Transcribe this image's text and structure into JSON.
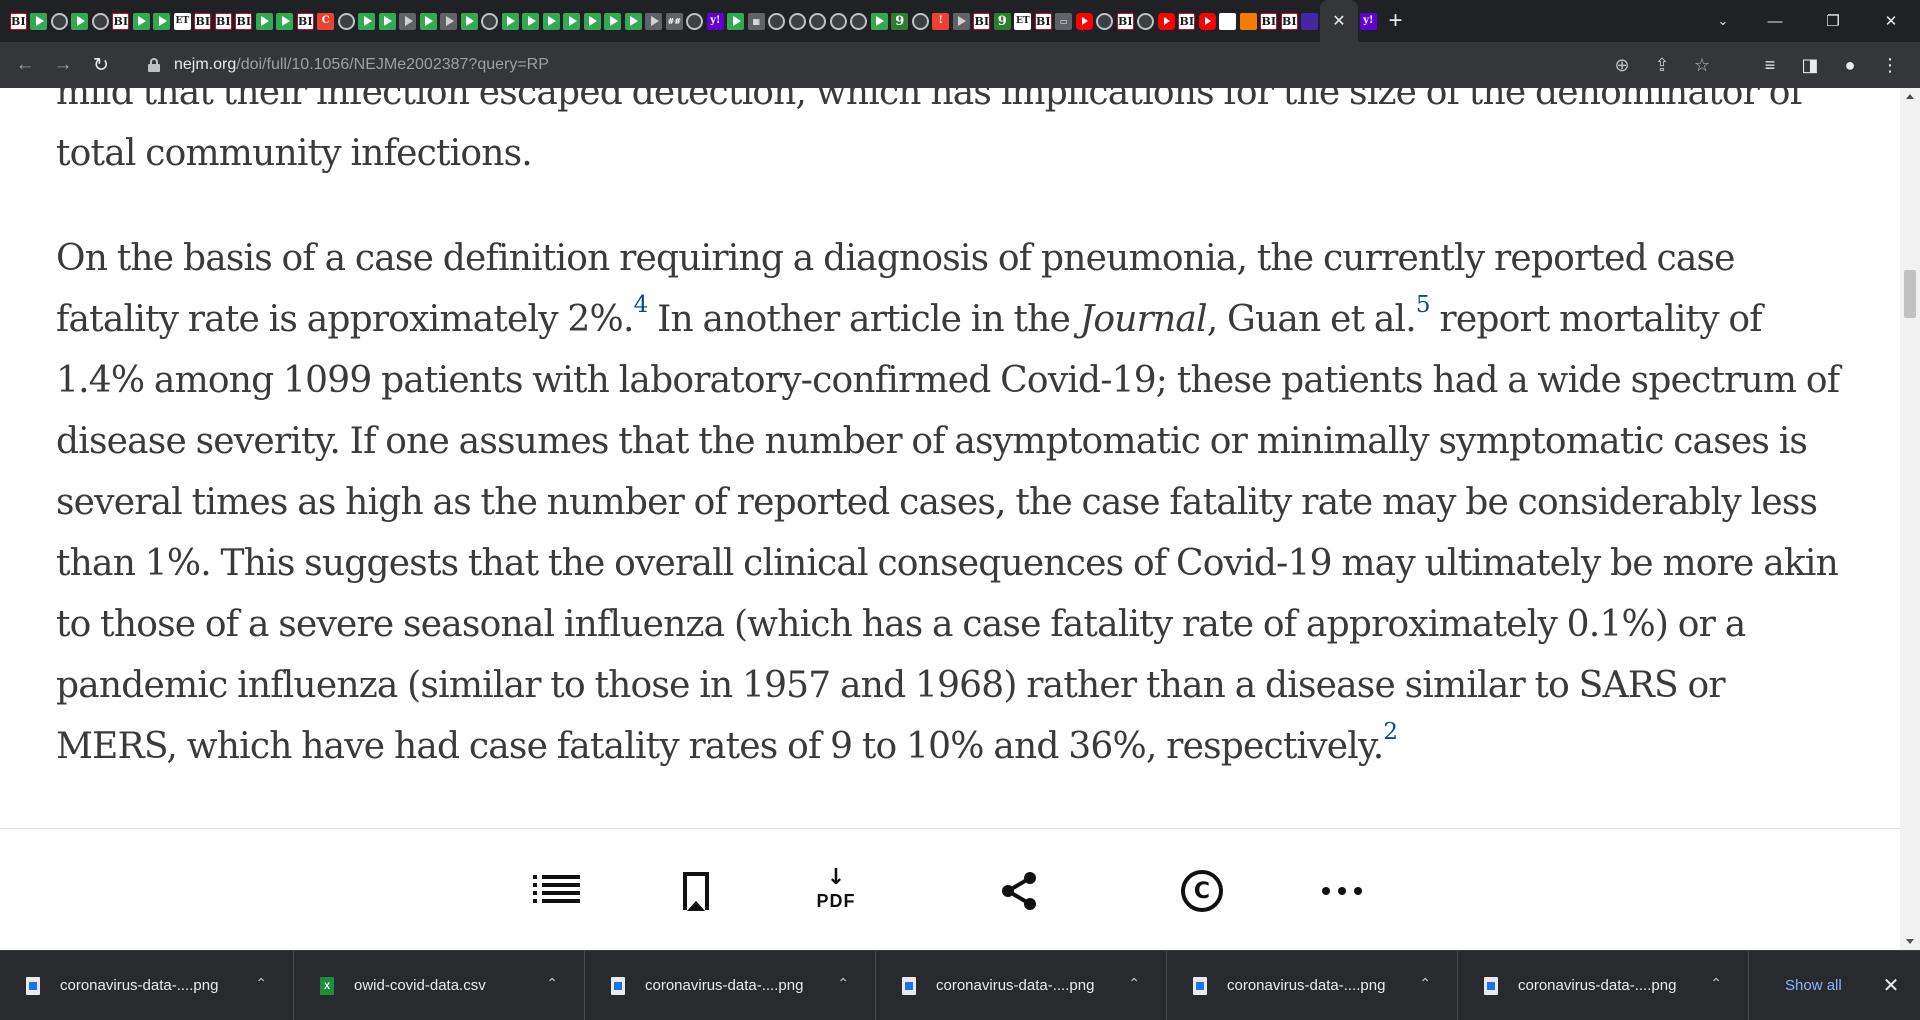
{
  "browser": {
    "tabs": [
      {
        "icon": "bi",
        "glyph": "BI"
      },
      {
        "icon": "play",
        "glyph": ""
      },
      {
        "icon": "globe",
        "glyph": ""
      },
      {
        "icon": "play",
        "glyph": ""
      },
      {
        "icon": "globe",
        "glyph": ""
      },
      {
        "icon": "bi",
        "glyph": "BI"
      },
      {
        "icon": "play",
        "glyph": ""
      },
      {
        "icon": "play",
        "glyph": ""
      },
      {
        "icon": "et",
        "glyph": "ET"
      },
      {
        "icon": "bi",
        "glyph": "BI"
      },
      {
        "icon": "bi",
        "glyph": "BI"
      },
      {
        "icon": "bi",
        "glyph": "BI"
      },
      {
        "icon": "play",
        "glyph": ""
      },
      {
        "icon": "play",
        "glyph": ""
      },
      {
        "icon": "bi",
        "glyph": "BI"
      },
      {
        "icon": "red",
        "glyph": "C"
      },
      {
        "icon": "globe",
        "glyph": ""
      },
      {
        "icon": "play",
        "glyph": ""
      },
      {
        "icon": "play",
        "glyph": ""
      },
      {
        "icon": "playgray",
        "glyph": ""
      },
      {
        "icon": "play",
        "glyph": ""
      },
      {
        "icon": "playgray",
        "glyph": ""
      },
      {
        "icon": "play",
        "glyph": ""
      },
      {
        "icon": "globe",
        "glyph": ""
      },
      {
        "icon": "play",
        "glyph": ""
      },
      {
        "icon": "play",
        "glyph": ""
      },
      {
        "icon": "play",
        "glyph": ""
      },
      {
        "icon": "play",
        "glyph": ""
      },
      {
        "icon": "play",
        "glyph": ""
      },
      {
        "icon": "play",
        "glyph": ""
      },
      {
        "icon": "play",
        "glyph": ""
      },
      {
        "icon": "playgray",
        "glyph": ""
      },
      {
        "icon": "grid",
        "glyph": "##"
      },
      {
        "icon": "globe",
        "glyph": ""
      },
      {
        "icon": "yahoo",
        "glyph": "y!"
      },
      {
        "icon": "play",
        "glyph": ""
      },
      {
        "icon": "grid",
        "glyph": "▦"
      },
      {
        "icon": "globe",
        "glyph": ""
      },
      {
        "icon": "globe",
        "glyph": ""
      },
      {
        "icon": "globe",
        "glyph": ""
      },
      {
        "icon": "globe",
        "glyph": ""
      },
      {
        "icon": "globe",
        "glyph": ""
      },
      {
        "icon": "play",
        "glyph": ""
      },
      {
        "icon": "g9",
        "glyph": "9"
      },
      {
        "icon": "globe",
        "glyph": ""
      },
      {
        "icon": "red",
        "glyph": "!"
      },
      {
        "icon": "playgray",
        "glyph": ""
      },
      {
        "icon": "bi",
        "glyph": "BI"
      },
      {
        "icon": "g9",
        "glyph": "9"
      },
      {
        "icon": "et",
        "glyph": "ET"
      },
      {
        "icon": "bi",
        "glyph": "BI"
      },
      {
        "icon": "grid",
        "glyph": "▭"
      },
      {
        "icon": "yt",
        "glyph": ""
      },
      {
        "icon": "globe",
        "glyph": ""
      },
      {
        "icon": "bi",
        "glyph": "BI"
      },
      {
        "icon": "globe",
        "glyph": ""
      },
      {
        "icon": "yt",
        "glyph": ""
      },
      {
        "icon": "bi",
        "glyph": "BI"
      },
      {
        "icon": "yt",
        "glyph": ""
      },
      {
        "icon": "flag",
        "glyph": ""
      },
      {
        "icon": "orange",
        "glyph": ""
      },
      {
        "icon": "bi",
        "glyph": "BI"
      },
      {
        "icon": "bi",
        "glyph": "BI"
      },
      {
        "icon": "purple",
        "glyph": ""
      }
    ],
    "active_tab_icon": "close-icon",
    "active_tab_close": "✕",
    "extra_tab_glyph": "y!",
    "new_tab": "+",
    "window_controls": {
      "list": "⌄",
      "minimize": "—",
      "restore": "❐",
      "close": "✕"
    },
    "url_host": "nejm.org",
    "url_path": "/doi/full/10.1056/NEJMe2002387?query=RP",
    "nav": {
      "back": "←",
      "forward": "→",
      "reload": "↻"
    },
    "omni_icons": {
      "zoom": "⊕",
      "share": "⇪",
      "star": "☆"
    },
    "toolbar_icons": {
      "reading_list": "≡",
      "side_panel": "◨",
      "profile": "●",
      "menu": "⋮"
    }
  },
  "article": {
    "paragraph1": "mild that their infection escaped detection, which has implications for the size of the denominator of total community infections.",
    "p2_part1": "On the basis of a case definition requiring a diagnosis of pneumonia, the currently reported case fatality rate is approximately 2%.",
    "ref_a": "4",
    "p2_part2": " In another article in the ",
    "journal": "Journal",
    "p2_part3": ", Guan et al.",
    "ref_b": "5",
    "p2_part4": " report mortality of 1.4% among 1099 patients with laboratory-confirmed Covid-19; these patients had a wide spectrum of disease severity. If one assumes that the number of asymptomatic or minimally symptomatic cases is several times as high as the number of reported cases, the case fatality rate may be considerably less than 1%. This suggests that the overall clinical consequences of Covid-19 may ultimately be more akin to those of a severe seasonal influenza (which has a case fatality rate of approximately 0.1%) or a pandemic influenza (similar to those in 1957 and 1968) rather than a disease similar to SARS or MERS, which have had case fatality rates of 9 to 10% and 36%, respectively.",
    "ref_c": "2"
  },
  "action_bar": {
    "pdf_label": "PDF",
    "pdf_arrow": "↓",
    "copyright_glyph": "C"
  },
  "downloads": {
    "items": [
      {
        "name": "coronavirus-data-....png",
        "type": "image"
      },
      {
        "name": "owid-covid-data.csv",
        "type": "csv"
      },
      {
        "name": "coronavirus-data-....png",
        "type": "image"
      },
      {
        "name": "coronavirus-data-....png",
        "type": "image"
      },
      {
        "name": "coronavirus-data-....png",
        "type": "image"
      },
      {
        "name": "coronavirus-data-....png",
        "type": "image"
      }
    ],
    "csv_icon_glyph": "X",
    "chevron": "⌃",
    "show_all": "Show all",
    "close": "✕"
  },
  "colors": {
    "reference_link": "#0b4a8a",
    "body_text": "#3a3a3a",
    "show_all_link": "#8ab4f8"
  }
}
